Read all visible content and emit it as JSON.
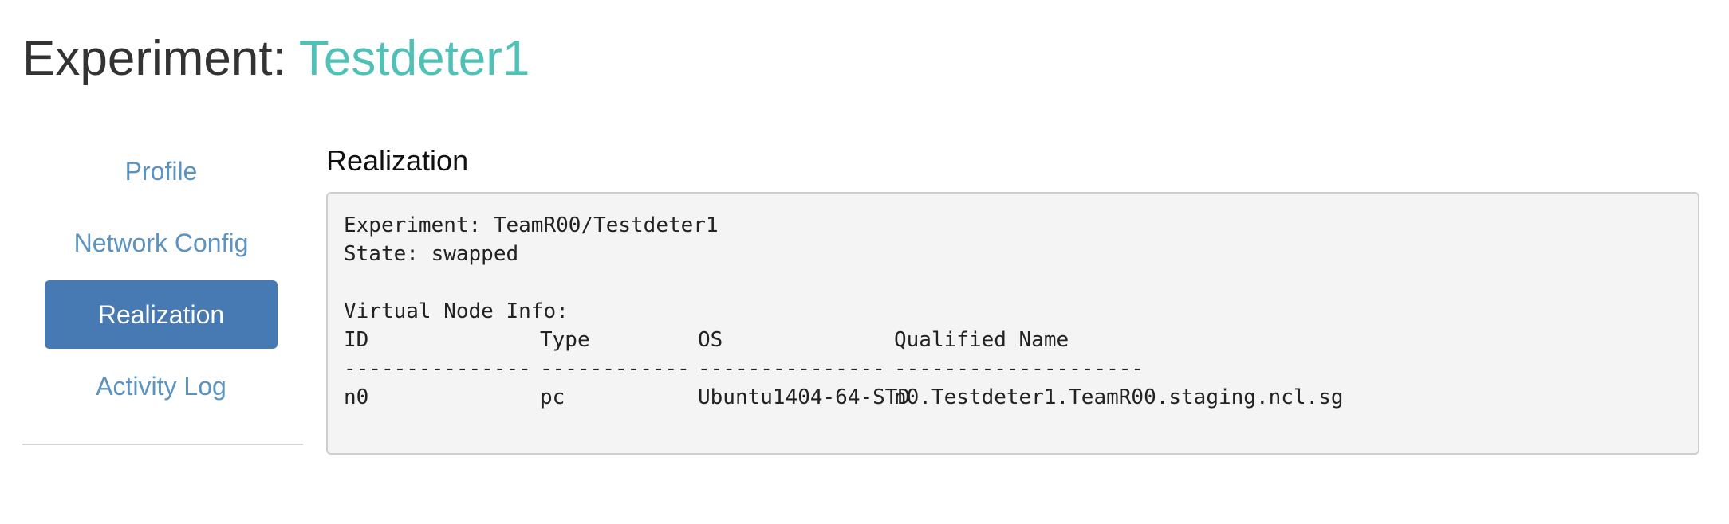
{
  "header": {
    "prefix": "Experiment: ",
    "experiment_name": "Testdeter1"
  },
  "sidebar": {
    "items": [
      {
        "label": "Profile",
        "active": false
      },
      {
        "label": "Network Config",
        "active": false
      },
      {
        "label": "Realization",
        "active": true
      },
      {
        "label": "Activity Log",
        "active": false
      }
    ]
  },
  "main": {
    "section_title": "Realization",
    "realization": {
      "experiment_line": "Experiment: TeamR00/Testdeter1",
      "state_line": "State: swapped",
      "virtual_node_heading": "Virtual Node Info:",
      "columns": [
        "ID",
        "Type",
        "OS",
        "Qualified Name"
      ],
      "separators": [
        "---------------",
        "------------",
        "---------------",
        "--------------------"
      ],
      "rows": [
        [
          "n0",
          "pc",
          "Ubuntu1404-64-STD",
          "n0.Testdeter1.TeamR00.staging.ncl.sg"
        ]
      ]
    }
  },
  "colors": {
    "accent_teal": "#4fc1b6",
    "nav_link": "#5b93c2",
    "nav_active_bg": "#4779b3"
  }
}
